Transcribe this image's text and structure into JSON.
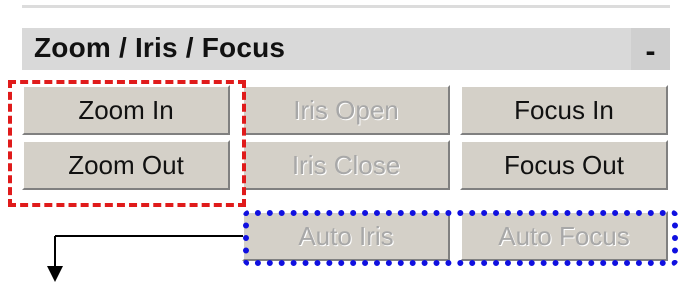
{
  "panel": {
    "title": "Zoom / Iris / Focus",
    "collapse_label": "-"
  },
  "buttons": {
    "zoom_in": "Zoom In",
    "iris_open": "Iris Open",
    "focus_in": "Focus In",
    "zoom_out": "Zoom Out",
    "iris_close": "Iris Close",
    "focus_out": "Focus Out",
    "auto_iris": "Auto Iris",
    "auto_focus": "Auto Focus"
  },
  "colors": {
    "highlight_red": "#e01b1b",
    "highlight_blue": "#1010e0",
    "button_face": "#d4d0c8",
    "disabled_text": "#a8a8a8"
  }
}
